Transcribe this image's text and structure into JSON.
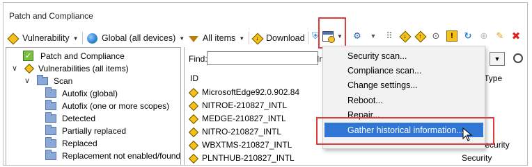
{
  "window": {
    "title": "Patch and Compliance"
  },
  "toolbar": {
    "vulnerability_label": "Vulnerability",
    "global_label": "Global (all devices)",
    "all_items_label": "All items",
    "download_label": "Download"
  },
  "tree": {
    "root": "Patch and Compliance",
    "vulnerabilities": "Vulnerabilities (all items)",
    "scan": "Scan",
    "children": [
      "Autofix (global)",
      "Autofix (one or more scopes)",
      "Detected",
      "Partially replaced",
      "Replaced",
      "Replacement not enabled/found"
    ]
  },
  "right_pane": {
    "find_label": "Find:",
    "find_value": "",
    "in_label": "In c",
    "id_header": "ID",
    "type_header": "y Type"
  },
  "rows": [
    {
      "id": "MicrosoftEdge92.0.902.84",
      "type": ""
    },
    {
      "id": "NITROE-210827_INTL",
      "type": ""
    },
    {
      "id": "MEDGE-210827_INTL",
      "type": ""
    },
    {
      "id": "NITRO-210827_INTL",
      "type": ""
    },
    {
      "id": "WBXTMS-210827_INTL",
      "type": "Non Security"
    },
    {
      "id": "PLNTHUB-210827_INTL",
      "type": "Security"
    }
  ],
  "menu": {
    "items": [
      "Security scan...",
      "Compliance scan...",
      "Change settings...",
      "Reboot...",
      "Repair...",
      "Gather historical information..."
    ],
    "active_index": 5
  },
  "colors": {
    "highlight_border": "#e03b3b",
    "menu_selected_bg": "#2f76d5",
    "warning_yellow": "#f6c21a"
  }
}
